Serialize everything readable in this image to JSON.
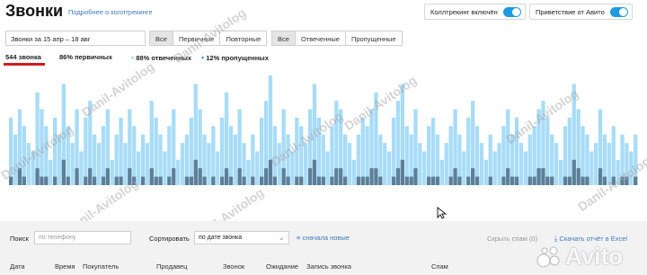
{
  "header": {
    "title": "Звонки",
    "help_link": "Подробнее о коллтрекинге",
    "calltracking_toggle": {
      "label": "Коллтрекинг включён",
      "on": true
    },
    "greeting_toggle": {
      "label": "Приветствие от Авито",
      "on": true
    }
  },
  "filters": {
    "date_range": "Звонки за 15 апр – 18 авг",
    "type_tabs": [
      "Все",
      "Первичные",
      "Повторные"
    ],
    "type_active": 0,
    "status_tabs": [
      "Все",
      "Отвеченные",
      "Пропущенные"
    ],
    "status_active": 0
  },
  "stats": {
    "total": "544 звонка",
    "primary": "86% первичных",
    "answered": "88% отвеченных",
    "missed": "12% пропущенных",
    "dot": "•"
  },
  "colors": {
    "accent": "#1e9ae0",
    "bar_light": "#a8dcf7",
    "bar_dark": "#5b7f99",
    "answered_dot": "#8fd3f5",
    "missed_dot": "#1e9ae0",
    "underline": "#d01c1c"
  },
  "chart_data": {
    "type": "bar",
    "series": [
      {
        "values": [
          8,
          6,
          9,
          7,
          5,
          4,
          11,
          9,
          7,
          3,
          8,
          6,
          12,
          7,
          5,
          9,
          4,
          8,
          10,
          6,
          5,
          7,
          9,
          3,
          6,
          8,
          5,
          9,
          7,
          4,
          6,
          5,
          10,
          8,
          6,
          4,
          7,
          9,
          3,
          5,
          6,
          8,
          12,
          9,
          6,
          5,
          7,
          4,
          8,
          11,
          7,
          6,
          9,
          5,
          3,
          6,
          4,
          8,
          10,
          13,
          7,
          5,
          9,
          6,
          4,
          8,
          7,
          5,
          9,
          12,
          8,
          6,
          4,
          7,
          10,
          9,
          6,
          5,
          3,
          6,
          8,
          7,
          9,
          11,
          6,
          5,
          4,
          8,
          10,
          12,
          7,
          6,
          9,
          5,
          4,
          7,
          8,
          6,
          3,
          5,
          7,
          9,
          6,
          4,
          8,
          10,
          7,
          5,
          3,
          6,
          4,
          5,
          7,
          9,
          6,
          8,
          5,
          4,
          6,
          7,
          9,
          10,
          8,
          6,
          5,
          3,
          7,
          8,
          12,
          9,
          7,
          6,
          4,
          5,
          9,
          6,
          5,
          7,
          3,
          6,
          5,
          4,
          6
        ]
      },
      {
        "values": [
          1,
          0,
          2,
          1,
          0,
          0,
          2,
          1,
          1,
          0,
          1,
          0,
          3,
          1,
          0,
          2,
          0,
          1,
          2,
          1,
          0,
          1,
          2,
          0,
          1,
          1,
          0,
          2,
          1,
          0,
          1,
          0,
          2,
          1,
          1,
          0,
          1,
          2,
          0,
          0,
          1,
          1,
          3,
          2,
          1,
          0,
          1,
          0,
          1,
          2,
          1,
          0,
          2,
          1,
          0,
          1,
          0,
          1,
          2,
          3,
          1,
          0,
          2,
          1,
          0,
          1,
          1,
          0,
          2,
          3,
          1,
          1,
          0,
          1,
          2,
          2,
          1,
          0,
          0,
          1,
          1,
          1,
          2,
          2,
          1,
          0,
          0,
          1,
          2,
          3,
          1,
          1,
          2,
          0,
          0,
          1,
          1,
          1,
          0,
          0,
          1,
          2,
          1,
          0,
          1,
          2,
          1,
          0,
          0,
          1,
          0,
          0,
          1,
          2,
          1,
          1,
          0,
          0,
          1,
          1,
          2,
          2,
          1,
          1,
          0,
          0,
          1,
          1,
          3,
          2,
          1,
          1,
          0,
          0,
          2,
          1,
          0,
          1,
          0,
          1,
          1,
          0,
          1
        ]
      }
    ]
  },
  "toolbar": {
    "search_label": "Поиск",
    "search_placeholder": "по телефону",
    "sort_label": "Сортировать",
    "sort_value": "по дате звонка",
    "new_first": "сначала новые",
    "hide_spam": "Скрыть спам (0)",
    "export": "Скачать отчёт в Excel"
  },
  "table": {
    "columns": [
      "Дата",
      "Время",
      "Покупатель",
      "Продавец",
      "Звонок",
      "Ожидание",
      "Запись звонка",
      "Спам"
    ]
  },
  "watermark": {
    "text": "Danil-Avitolog"
  },
  "logo": {
    "text": "Avito"
  }
}
